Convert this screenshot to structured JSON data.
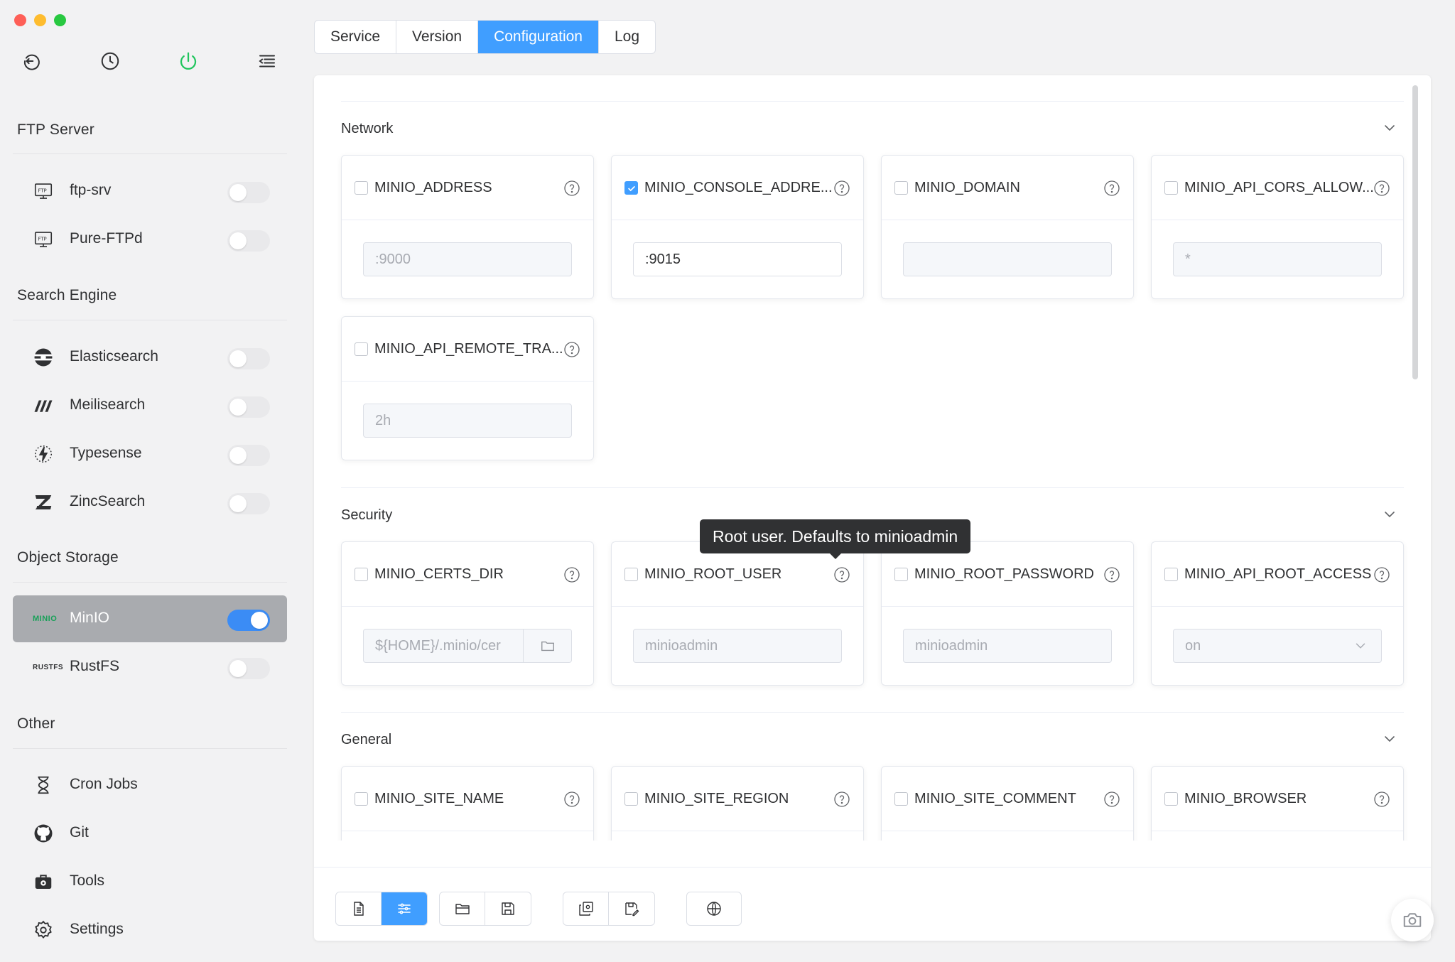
{
  "sidebar": {
    "sections": [
      {
        "title": "FTP Server",
        "items": [
          {
            "label": "ftp-srv",
            "icon": "ftp-icon",
            "on": false
          },
          {
            "label": "Pure-FTPd",
            "icon": "ftp-icon",
            "on": false
          }
        ]
      },
      {
        "title": "Search Engine",
        "items": [
          {
            "label": "Elasticsearch",
            "icon": "elasticsearch-icon",
            "on": false
          },
          {
            "label": "Meilisearch",
            "icon": "meilisearch-icon",
            "on": false
          },
          {
            "label": "Typesense",
            "icon": "typesense-icon",
            "on": false
          },
          {
            "label": "ZincSearch",
            "icon": "zincsearch-icon",
            "on": false
          }
        ]
      },
      {
        "title": "Object Storage",
        "items": [
          {
            "label": "MinIO",
            "icon": "minio-icon",
            "brand": "MINIO",
            "on": true
          },
          {
            "label": "RustFS",
            "icon": "rustfs-icon",
            "brand": "RUSTFS",
            "on": false
          }
        ]
      },
      {
        "title": "Other",
        "items": [
          {
            "label": "Cron Jobs",
            "icon": "hourglass-icon"
          },
          {
            "label": "Git",
            "icon": "github-icon"
          },
          {
            "label": "Tools",
            "icon": "toolbox-icon"
          },
          {
            "label": "Settings",
            "icon": "gear-icon"
          }
        ]
      }
    ]
  },
  "tabs": [
    {
      "label": "Service",
      "active": false
    },
    {
      "label": "Version",
      "active": false
    },
    {
      "label": "Configuration",
      "active": true
    },
    {
      "label": "Log",
      "active": false
    }
  ],
  "groups": {
    "network": {
      "title": "Network",
      "cards": [
        {
          "key": "MINIO_ADDRESS",
          "checked": false,
          "value": ":9000"
        },
        {
          "key": "MINIO_CONSOLE_ADDRE...",
          "checked": true,
          "value": ":9015"
        },
        {
          "key": "MINIO_DOMAIN",
          "checked": false,
          "value": ""
        },
        {
          "key": "MINIO_API_CORS_ALLOW...",
          "checked": false,
          "value": "*"
        },
        {
          "key": "MINIO_API_REMOTE_TRA...",
          "checked": false,
          "value": "2h"
        }
      ]
    },
    "security": {
      "title": "Security",
      "cards": [
        {
          "key": "MINIO_CERTS_DIR",
          "checked": false,
          "value": "${HOME}/.minio/cer"
        },
        {
          "key": "MINIO_ROOT_USER",
          "checked": false,
          "value": "minioadmin"
        },
        {
          "key": "MINIO_ROOT_PASSWORD",
          "checked": false,
          "value": "minioadmin"
        },
        {
          "key": "MINIO_API_ROOT_ACCESS",
          "checked": false,
          "value": "on"
        }
      ]
    },
    "general": {
      "title": "General",
      "cards": [
        {
          "key": "MINIO_SITE_NAME",
          "checked": false
        },
        {
          "key": "MINIO_SITE_REGION",
          "checked": false
        },
        {
          "key": "MINIO_SITE_COMMENT",
          "checked": false
        },
        {
          "key": "MINIO_BROWSER",
          "checked": false
        }
      ]
    }
  },
  "tooltip": {
    "text": "Root user. Defaults to minioadmin"
  },
  "toolbar": {
    "buttons": [
      {
        "icon": "document-icon",
        "active": false
      },
      {
        "icon": "sliders-icon",
        "active": true
      },
      {
        "icon": "folder-icon",
        "active": false
      },
      {
        "icon": "save-icon",
        "active": false
      },
      {
        "icon": "image-copy-icon",
        "active": false
      },
      {
        "icon": "save-as-icon",
        "active": false
      },
      {
        "icon": "globe-icon",
        "active": false
      }
    ]
  },
  "colors": {
    "accent": "#409eff",
    "toggle_on": "#3b8cf5",
    "active_sidebar": "#a9abaf",
    "power_green": "#22c55e",
    "minio_green": "#18a058"
  }
}
